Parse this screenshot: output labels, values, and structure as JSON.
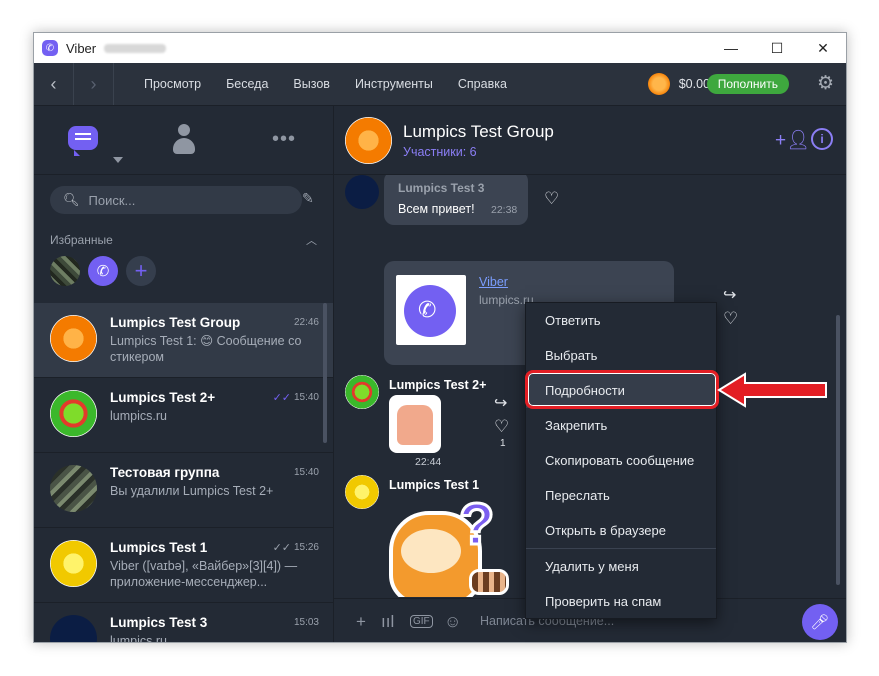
{
  "window": {
    "title": "Viber",
    "controls": {
      "minimize": "—",
      "maximize": "☐",
      "close": "✕"
    }
  },
  "menubar": {
    "back": "‹",
    "forward": "›",
    "items": [
      "Просмотр",
      "Беседа",
      "Вызов",
      "Инструменты",
      "Справка"
    ],
    "balance": "$0.00",
    "topup_label": "Пополнить",
    "settings_glyph": "⚙"
  },
  "sidebar": {
    "more_glyph": "•••",
    "search_placeholder": "Поиск...",
    "favorites_label": "Избранные",
    "chats": [
      {
        "name": "Lumpics Test Group",
        "time": "22:46",
        "preview": "Lumpics Test 1: 😊 Сообщение со стикером",
        "ticks": ""
      },
      {
        "name": "Lumpics Test 2+",
        "time": "15:40",
        "preview": "lumpics.ru",
        "ticks": "✓✓"
      },
      {
        "name": "Тестовая группа",
        "time": "15:40",
        "preview": "Вы удалили Lumpics Test 2+",
        "ticks": ""
      },
      {
        "name": "Lumpics Test 1",
        "time": "15:26",
        "preview": "Viber ([vaɪbə], «Вайбер»[3][4]) — приложение-мессенджер...",
        "ticks": "✓✓"
      },
      {
        "name": "Lumpics Test 3",
        "time": "15:03",
        "preview": "lumpics.ru",
        "ticks": ""
      }
    ]
  },
  "chat": {
    "title": "Lumpics Test Group",
    "subtitle": "Участники: 6",
    "info_glyph": "i",
    "messages": {
      "m1": {
        "sender": "Lumpics Test 3",
        "text": "Всем привет!",
        "time": "22:38"
      },
      "m2": {
        "link_title": "Viber",
        "link_host": "lumpics.ru"
      },
      "m3": {
        "sender": "Lumpics Test 2+",
        "time": "22:44",
        "likes": "1"
      },
      "m4": {
        "sender": "Lumpics Test 1"
      }
    },
    "input_placeholder": "Написать сообщение..."
  },
  "context_menu": {
    "items": [
      "Ответить",
      "Выбрать",
      "Подробности",
      "Закрепить",
      "Скопировать сообщение",
      "Переслать",
      "Открыть в браузере",
      "Удалить у меня",
      "Проверить на спам"
    ],
    "highlighted_index": 2
  },
  "colors": {
    "accent": "#7360f2",
    "annotation": "#e31e24",
    "topup": "#3ea83e",
    "background": "#232a35"
  }
}
